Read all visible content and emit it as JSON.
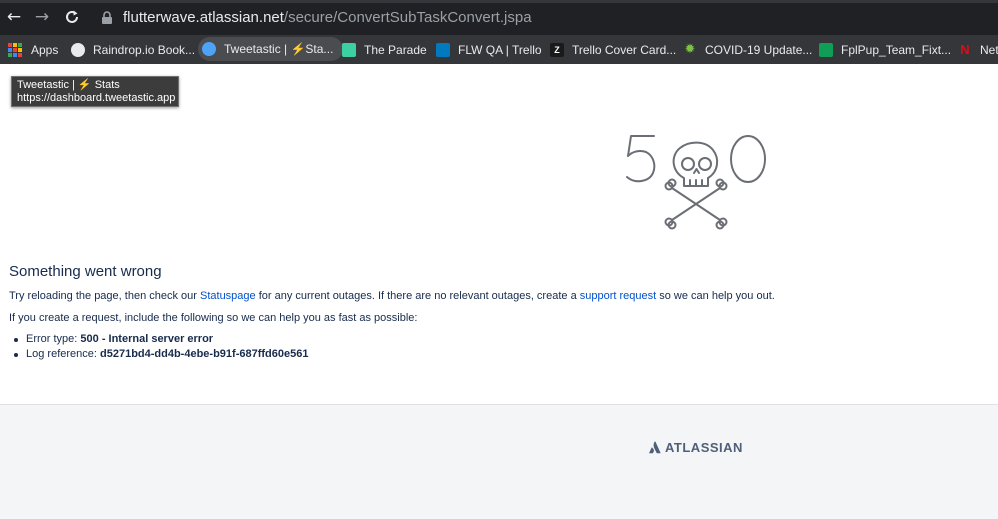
{
  "browser": {
    "url_host": "flutterwave.atlassian.net",
    "url_path": "/secure/ConvertSubTaskConvert.jspa",
    "bookmarks": [
      {
        "label": "Apps",
        "icon": "apps-grid-icon"
      },
      {
        "label": "Raindrop.io Book...",
        "icon": "raindrop-icon"
      },
      {
        "label": "Tweetastic | ⚡Sta...",
        "icon": "tweetastic-icon"
      },
      {
        "label": "The Parade",
        "icon": "parade-icon"
      },
      {
        "label": "FLW QA | Trello",
        "icon": "trello-icon"
      },
      {
        "label": "Trello Cover Card...",
        "icon": "z-icon"
      },
      {
        "label": "COVID-19 Update...",
        "icon": "virus-icon"
      },
      {
        "label": "FplPup_Team_Fixt...",
        "icon": "sheets-icon"
      },
      {
        "label": "Net",
        "icon": "netflix-icon"
      }
    ],
    "tooltip": {
      "title": "Tweetastic | ⚡ Stats",
      "url": "https://dashboard.tweetastic.app"
    }
  },
  "error": {
    "heading": "Something went wrong",
    "line1_before": "Try reloading the page, then check our ",
    "statuspage_link": "Statuspage",
    "line1_middle": " for any current outages. If there are no relevant outages, create a ",
    "support_link": "support request",
    "line1_after": " so we can help you out.",
    "line2": "If you create a request, include the following so we can help you as fast as possible:",
    "details": [
      {
        "label": "Error type: ",
        "value": "500 - Internal server error"
      },
      {
        "label": "Log reference: ",
        "value": "d5271bd4-dd4b-4ebe-b91f-687ffd60e561"
      }
    ]
  },
  "footer": {
    "brand": "ATLASSIAN"
  },
  "colors": {
    "text": "#172b4d",
    "link": "#0052cc",
    "footer_bg": "#f4f5f7",
    "logo": "#505f79"
  }
}
